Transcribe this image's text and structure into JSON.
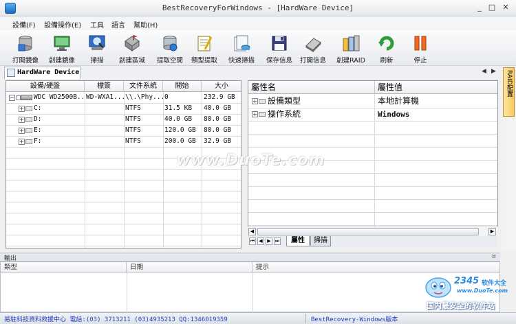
{
  "window": {
    "title": "BestRecoveryForWindows - [HardWare Device]",
    "minimize": "_",
    "restore": "□",
    "close": "✕"
  },
  "menu": [
    "設備(F)",
    "設備操作(E)",
    "工具",
    "語言",
    "幫助(H)"
  ],
  "toolbar": [
    {
      "label": "打開鏡像",
      "icon": "open-image-icon"
    },
    {
      "label": "創建鏡像",
      "icon": "create-image-icon"
    },
    {
      "label": "掃描",
      "icon": "scan-icon"
    },
    {
      "label": "創建區域",
      "icon": "create-region-icon"
    },
    {
      "label": "提取空閒",
      "icon": "extract-free-icon"
    },
    {
      "label": "類型提取",
      "icon": "type-extract-icon"
    },
    {
      "label": "快速掃描",
      "icon": "quick-scan-icon"
    },
    {
      "label": "保存信息",
      "icon": "save-info-icon"
    },
    {
      "label": "打開信息",
      "icon": "open-info-icon"
    },
    {
      "label": "創建RAID",
      "icon": "create-raid-icon"
    },
    {
      "label": "刷新",
      "icon": "refresh-icon"
    },
    {
      "label": "停止",
      "icon": "stop-icon"
    }
  ],
  "doc_tab": "HardWare Device",
  "raid_tab": "RAID配置",
  "device_table": {
    "columns": [
      "設備/硬盤",
      "標簽",
      "文件系統",
      "開始",
      "大小"
    ],
    "rows": [
      {
        "name": "WDC WD2500B...",
        "label": "WD-WXA1...",
        "fs": "\\\\.\\Phy...",
        "start": "0",
        "size": "232.9 GB"
      },
      {
        "name": "C:",
        "label": "",
        "fs": "NTFS",
        "start": "31.5 KB",
        "size": "40.0 GB"
      },
      {
        "name": "D:",
        "label": "",
        "fs": "NTFS",
        "start": "40.0 GB",
        "size": "80.0 GB"
      },
      {
        "name": "E:",
        "label": "",
        "fs": "NTFS",
        "start": "120.0 GB",
        "size": "80.0 GB"
      },
      {
        "name": "F:",
        "label": "",
        "fs": "NTFS",
        "start": "200.0 GB",
        "size": "32.9 GB"
      }
    ]
  },
  "property_table": {
    "columns": [
      "屬性名",
      "屬性值"
    ],
    "rows": [
      {
        "name": "設備類型",
        "value": "本地計算機"
      },
      {
        "name": "操作系統",
        "value": "Windows"
      }
    ]
  },
  "bottom_tabs": [
    "屬性",
    "掃描"
  ],
  "output": {
    "title": "輸出",
    "columns": [
      "類型",
      "日期",
      "提示"
    ]
  },
  "status": {
    "left": "易駐科技資料救援中心 電話:(03) 3713211 (03)4935213  QQ:1346019359",
    "right": "BestRecovery-Windows版本"
  },
  "watermark": "www.DuoTe.com",
  "logo": {
    "num": "2345",
    "cn": "软件大全",
    "url": "www.DuoTe.com",
    "slogan": "国内最安全的软件站"
  }
}
